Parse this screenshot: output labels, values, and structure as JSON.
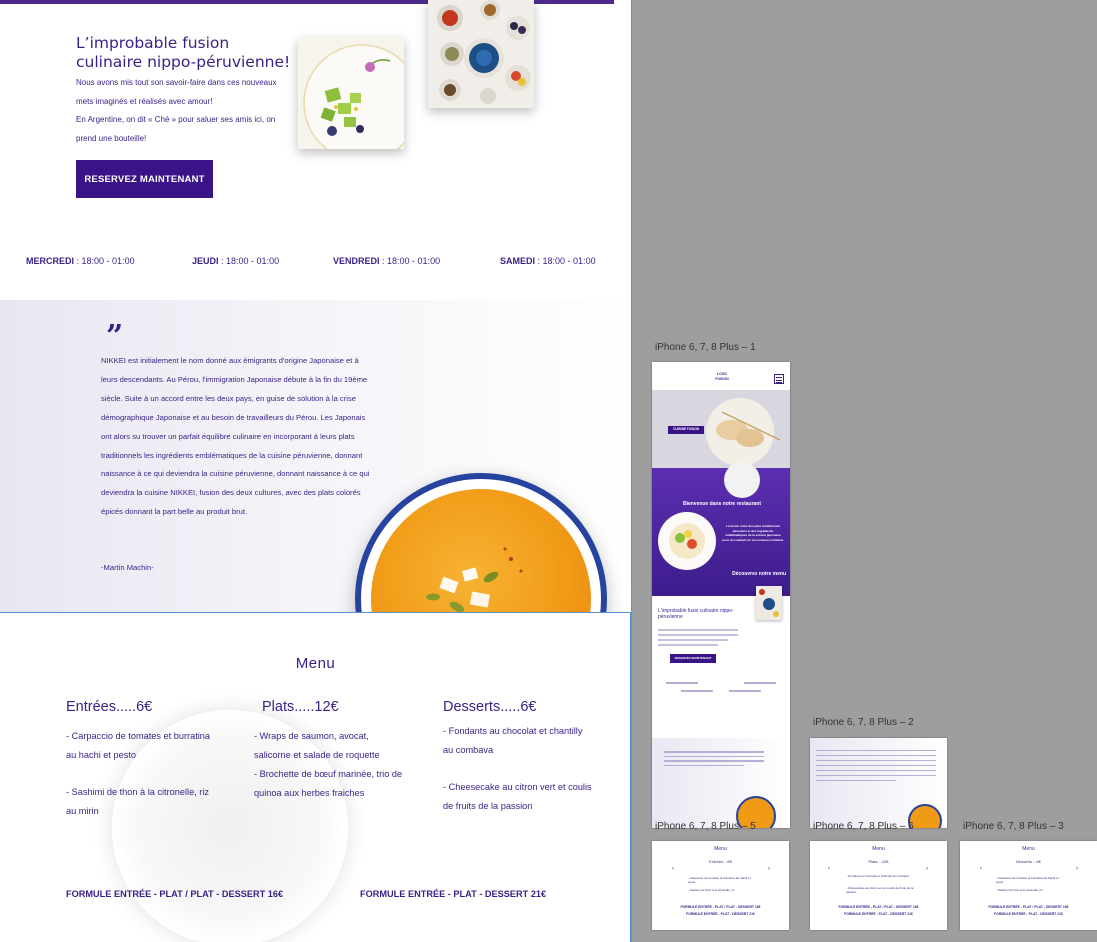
{
  "hero": {
    "title_line1": "L’improbable fusion",
    "title_line2": "culinaire nippo-péruvienne!",
    "para1": "Nous avons mis tout son savoir-faire dans ces nouveaux mets imaginés et réalisés avec amour!",
    "para2": "En Argentine, on dit « Ché » pour saluer ses amis ici, on prend une bouteille!",
    "cta": "RESERVEZ MAINTENANT"
  },
  "hours": [
    {
      "day": "MERCREDI",
      "time": "18:00 - 01:00"
    },
    {
      "day": "JEUDI",
      "time": "18:00 - 01:00"
    },
    {
      "day": "VENDREDI",
      "time": "18:00 - 01:00"
    },
    {
      "day": "SAMEDI",
      "time": "18:00 - 01:00"
    }
  ],
  "quote": {
    "mark": "”",
    "text": "NIKKEI est initialement le nom donné aux émigrants d'origine Japonaise et à leurs descendants. Au Pérou, l'immigration Japonaise débute à la fin du 19ème siècle. Suite à un accord entre les deux pays, en guise de solution à la crise démographique Japonaise et au besoin de travailleurs du Pérou. Les Japonais ont alors su trouver un parfait équilibre culinaire en incorporant à leurs plats traditionnels les ingrédients emblématiques de la cuisine péruvienne, donnant naissance à ce qui deviendra la cuisine péruvienne, donnant naissance à ce qui deviendra la cuisine NIKKEI, fusion des deux cultures, avec des plats colorés épicés donnant la part belle au produit brut.",
    "author": "-Martin Machin-"
  },
  "menu": {
    "title": "Menu",
    "columns": [
      {
        "title": "Entrées.....6€",
        "lines": [
          "- Carpaccio de tomates et burratina",
          "au hachi et pesto",
          "",
          "- Sashimi de thon à la citronelle, riz",
          "au mirin"
        ]
      },
      {
        "title": "Plats.....12€",
        "lines": [
          "- Wraps de saumon, avocat,",
          "salicorne et salade de roquette",
          "- Brochette de bœuf marinée, trio de",
          "quinoa aux herbes fraiches"
        ]
      },
      {
        "title": "Desserts.....6€",
        "lines": [
          "- Fondants au chocolat et chantilly",
          "au combava",
          "",
          "- Cheesecake au citron vert et coulis",
          "de fruits de la passion"
        ]
      }
    ],
    "formula1": "FORMULE ENTRÉE - PLAT / PLAT - DESSERT 16€",
    "formula2": "FORMULE ENTRÉE - PLAT - DESSERT 21€"
  },
  "artboards": {
    "labels": [
      "iPhone 6, 7, 8 Plus – 1",
      "iPhone 6, 7, 8 Plus – 2",
      "iPhone 6, 7, 8 Plus – 5",
      "iPhone 6, 7, 8 Plus – 6",
      "iPhone 6, 7, 8 Plus – 3"
    ],
    "p1": {
      "logo": "LOGO FUSION",
      "badge": "CUISINE FUSION",
      "welcome": "Bienvenue dans notre restaurant",
      "blurb": "La fusion entre des plats traditionnels péruviens et des ingrédients emblématiques de la cuisine japonaise pour un cocktail sur un nouveau continent.",
      "discover": "Découvrez notre menu",
      "title": "L'improbable fusio culinaire nippo-péruvienne",
      "cta": "RESERVEZ MAINTENANT"
    },
    "mini_menu_title": "Menu",
    "mini_cards": [
      {
        "head": "Entrées....6€",
        "l1": "- Carpaccio de tomates et burratina au hachi et pesto",
        "l2": "- Sashimi de thon à la citronelle, riz"
      },
      {
        "head": "Plats....12€",
        "l1": "- Fondants au chocolat et chantilly au combava",
        "l2": "- Cheesecake au citron vert et coulis de fruits de la passion"
      },
      {
        "head": "Desserts....6€",
        "l1": "- Carpaccio de tomates et burratina au hachi et pesto",
        "l2": "- Sashimi de thon à la citronelle, riz"
      }
    ],
    "mini_f1": "FORMULE ENTRÉE - PLAT / PLAT - DESSERT 16€",
    "mini_f2": "FORMULE ENTRÉE - PLAT - DESSERT 21€"
  },
  "colors": {
    "brand": "#3a1f86",
    "accent": "#3a1486",
    "selection": "#5b8fe0"
  }
}
